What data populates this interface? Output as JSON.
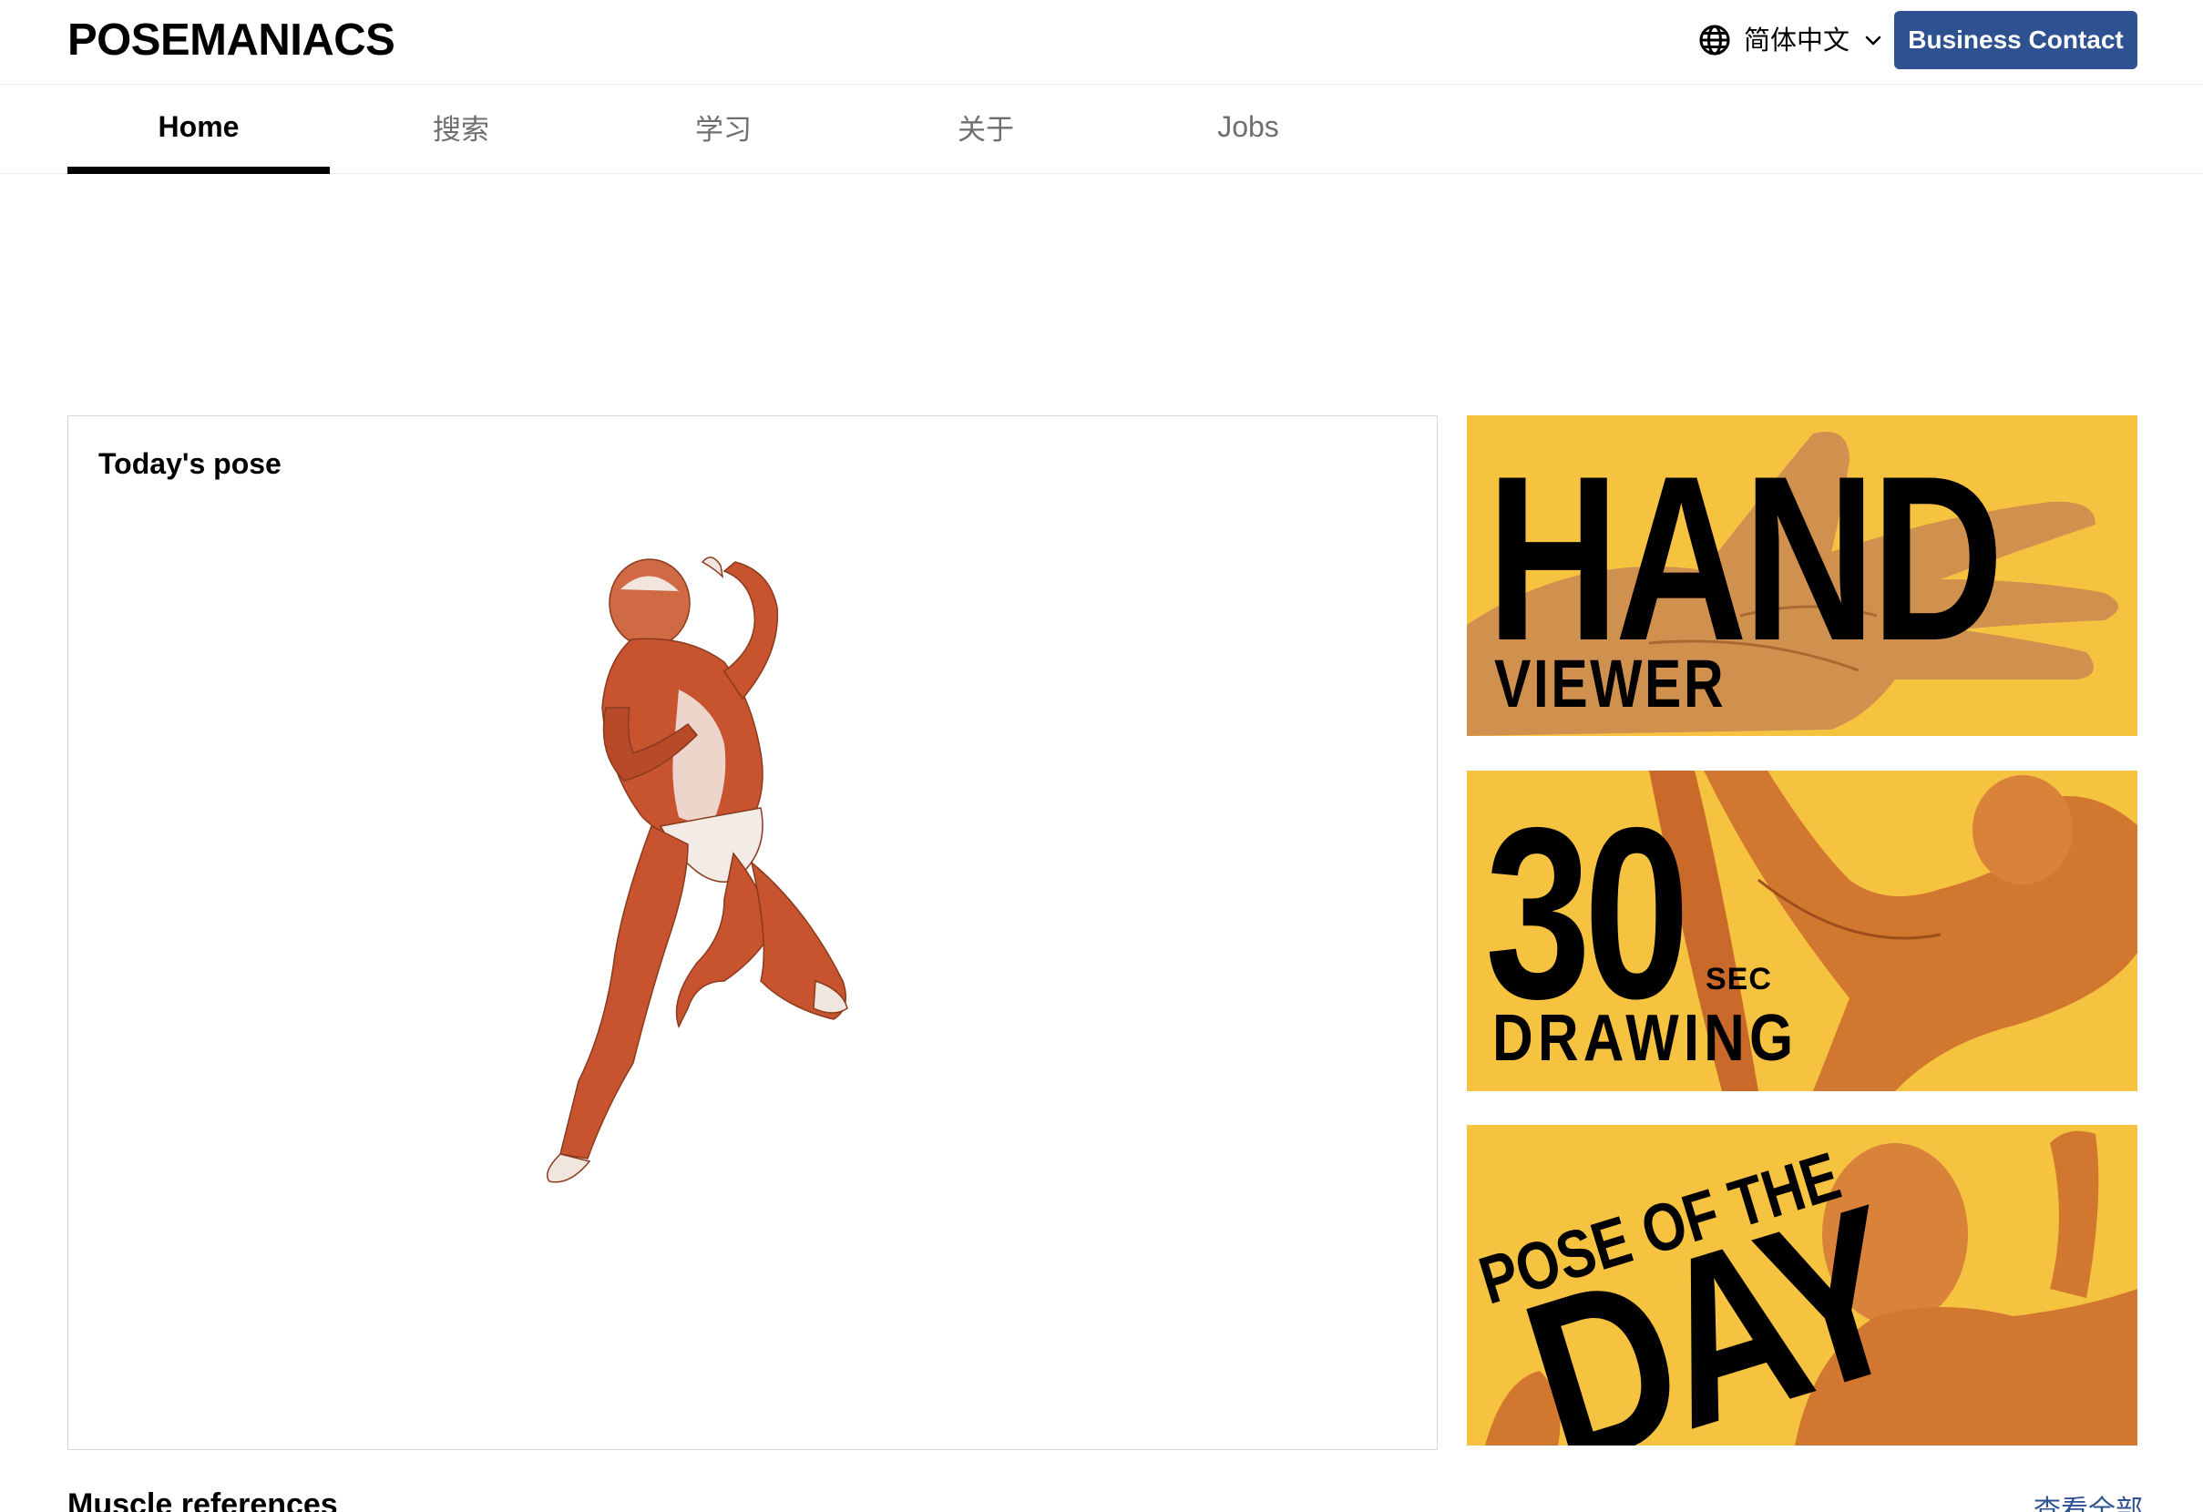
{
  "header": {
    "logo": "POSEMANIACS",
    "language": {
      "icon": "globe-icon",
      "label": "简体中文",
      "chevron": "chevron-down-icon"
    },
    "business_button": "Business Contact"
  },
  "tabs": [
    {
      "label": "Home",
      "active": true
    },
    {
      "label": "搜索",
      "active": false
    },
    {
      "label": "学习",
      "active": false
    },
    {
      "label": "关于",
      "active": false
    },
    {
      "label": "Jobs",
      "active": false
    }
  ],
  "today_pose": {
    "title": "Today's pose",
    "image": "muscle-figure-jumping"
  },
  "banners": [
    {
      "big": "HAND",
      "small": "VIEWER",
      "image": "hand-anatomy"
    },
    {
      "big": "30",
      "unit": "SEC",
      "small": "DRAWING",
      "image": "muscle-figure-arms"
    },
    {
      "small": "POSE OF THE",
      "big": "DAY",
      "image": "muscle-figure-torso"
    }
  ],
  "sections": {
    "muscle_title": "Muscle references",
    "see_all": "查看全部"
  },
  "colors": {
    "accent": "#2e5291",
    "banner_bg": "#f5c33f",
    "muscle": "#c8532f",
    "tendon": "#f3ece6"
  }
}
